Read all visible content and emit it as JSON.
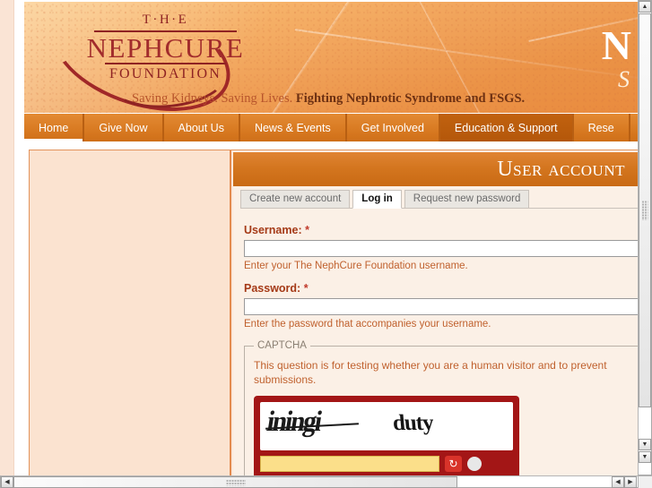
{
  "site": {
    "logo": {
      "line1": "T·H·E",
      "line2": "NEPHCURE",
      "line3": "FOUNDATION"
    },
    "tagline_light": "Saving Kidneys. Saving Lives.",
    "tagline_bold": "Fighting Nephrotic Syndrome and FSGS.",
    "banner_big_letter": "N",
    "banner_big_sub": "S"
  },
  "nav": {
    "items": [
      {
        "label": "Home",
        "active": false
      },
      {
        "label": "Give Now",
        "active": false
      },
      {
        "label": "About Us",
        "active": false
      },
      {
        "label": "News & Events",
        "active": false
      },
      {
        "label": "Get Involved",
        "active": false
      },
      {
        "label": "Education & Support",
        "active": true
      },
      {
        "label": "Rese",
        "active": false
      }
    ]
  },
  "page": {
    "title": "User account"
  },
  "tabs": [
    {
      "label": "Create new account",
      "active": false
    },
    {
      "label": "Log in",
      "active": true
    },
    {
      "label": "Request new password",
      "active": false
    }
  ],
  "form": {
    "username": {
      "label": "Username:",
      "required_marker": "*",
      "value": "",
      "description": "Enter your The NephCure Foundation username."
    },
    "password": {
      "label": "Password:",
      "required_marker": "*",
      "value": "",
      "description": "Enter the password that accompanies your username."
    },
    "captcha": {
      "legend": "CAPTCHA",
      "description": "This question is for testing whether you are a human visitor and to prevent submissions.",
      "image_word_1": "iningi",
      "image_word_2": "duty",
      "answer_value": "",
      "refresh_icon": "refresh-icon",
      "refresh_glyph": "↻"
    }
  },
  "scrollbars": {
    "vertical": {
      "up_glyph": "▲",
      "down_glyph": "▼"
    },
    "horizontal": {
      "left_glyph": "◀",
      "right_glyph": "▶"
    }
  },
  "colors": {
    "brand_orange": "#d9772a",
    "brand_dark_red": "#8f2323",
    "nav_active": "#b4570a",
    "label_color": "#a53a17",
    "desc_color": "#c0612e",
    "captcha_red": "#a31616",
    "panel_bg": "#fbf0e6",
    "sidebar_bg": "#fbe3d0"
  }
}
